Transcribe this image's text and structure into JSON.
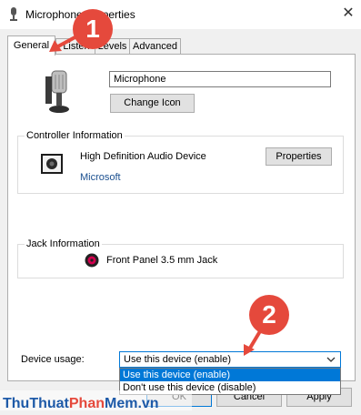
{
  "window": {
    "title": "Microphone Properties",
    "title_icon": "microphone-icon",
    "close_glyph": "✕"
  },
  "tabs": [
    {
      "label": "General",
      "active": true
    },
    {
      "label": "Listen",
      "active": false
    },
    {
      "label": "Levels",
      "active": false
    },
    {
      "label": "Advanced",
      "active": false
    }
  ],
  "general": {
    "device_name": "Microphone",
    "change_icon_label": "Change Icon",
    "controller": {
      "group_label": "Controller Information",
      "device": "High Definition Audio Device",
      "vendor": "Microsoft",
      "properties_label": "Properties"
    },
    "jack": {
      "group_label": "Jack Information",
      "connector": "Front Panel 3.5 mm Jack",
      "connector_color": "#d2004e"
    },
    "usage": {
      "label": "Device usage:",
      "selected": "Use this device (enable)",
      "options": [
        "Use this device (enable)",
        "Don't use this device (disable)"
      ]
    }
  },
  "footer": {
    "ok_label": "OK",
    "cancel_label": "Cancel",
    "apply_label": "Apply"
  },
  "annotations": {
    "badges": [
      "1",
      "2"
    ],
    "color": "#e5493c"
  },
  "watermark": {
    "parts": [
      "Thu",
      "Thuat",
      "Phan",
      "Mem",
      ".vn"
    ],
    "colors": [
      "#1e5aa8",
      "#e5493c"
    ]
  }
}
